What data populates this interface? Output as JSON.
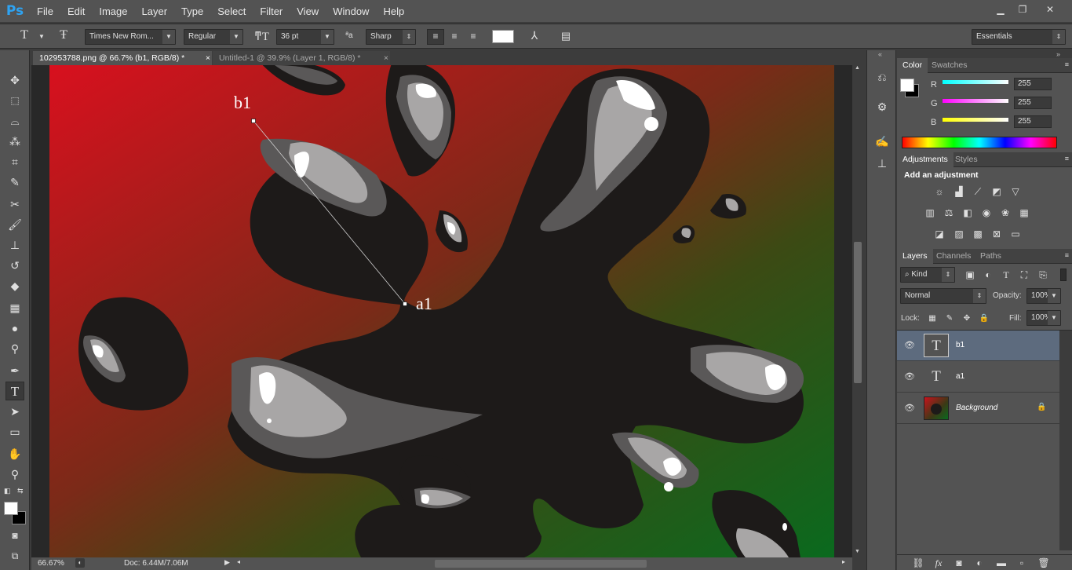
{
  "app": {
    "logo": "Ps"
  },
  "menu": [
    "File",
    "Edit",
    "Image",
    "Layer",
    "Type",
    "Select",
    "Filter",
    "View",
    "Window",
    "Help"
  ],
  "window": {
    "minimize": "▁",
    "restore": "❐",
    "close": "✕"
  },
  "options": {
    "font_family": "Times New Rom...",
    "font_style": "Regular",
    "font_size": "36 pt",
    "anti_alias": "Sharp",
    "workspace": "Essentials",
    "text_color": "#ffffff"
  },
  "tabs": [
    {
      "label": "102953788.png @ 66.7% (b1, RGB/8) *",
      "close": "×"
    },
    {
      "label": "Untitled-1 @ 39.9% (Layer 1, RGB/8) *",
      "close": "×"
    }
  ],
  "canvas": {
    "label_b1": "b1",
    "label_a1": "a1"
  },
  "status": {
    "zoom": "66.67%",
    "doc": "Doc: 6.44M/7.06M"
  },
  "color_panel": {
    "tabs": [
      "Color",
      "Swatches"
    ],
    "r_label": "R",
    "g_label": "G",
    "b_label": "B",
    "r": "255",
    "g": "255",
    "b": "255"
  },
  "adjustments": {
    "tabs": [
      "Adjustments",
      "Styles"
    ],
    "title": "Add an adjustment"
  },
  "layers_panel": {
    "tabs": [
      "Layers",
      "Channels",
      "Paths"
    ],
    "kind": "Kind",
    "blend_mode": "Normal",
    "opacity_label": "Opacity:",
    "opacity": "100%",
    "lock_label": "Lock:",
    "fill_label": "Fill:",
    "fill": "100%",
    "layers": [
      {
        "name": "b1",
        "thumb": "T"
      },
      {
        "name": "a1",
        "thumb": "T"
      },
      {
        "name": "Background"
      }
    ]
  },
  "colors": {
    "accent": "#2ea3f2",
    "panel": "#535353",
    "selected_layer": "#5d6b7e"
  }
}
